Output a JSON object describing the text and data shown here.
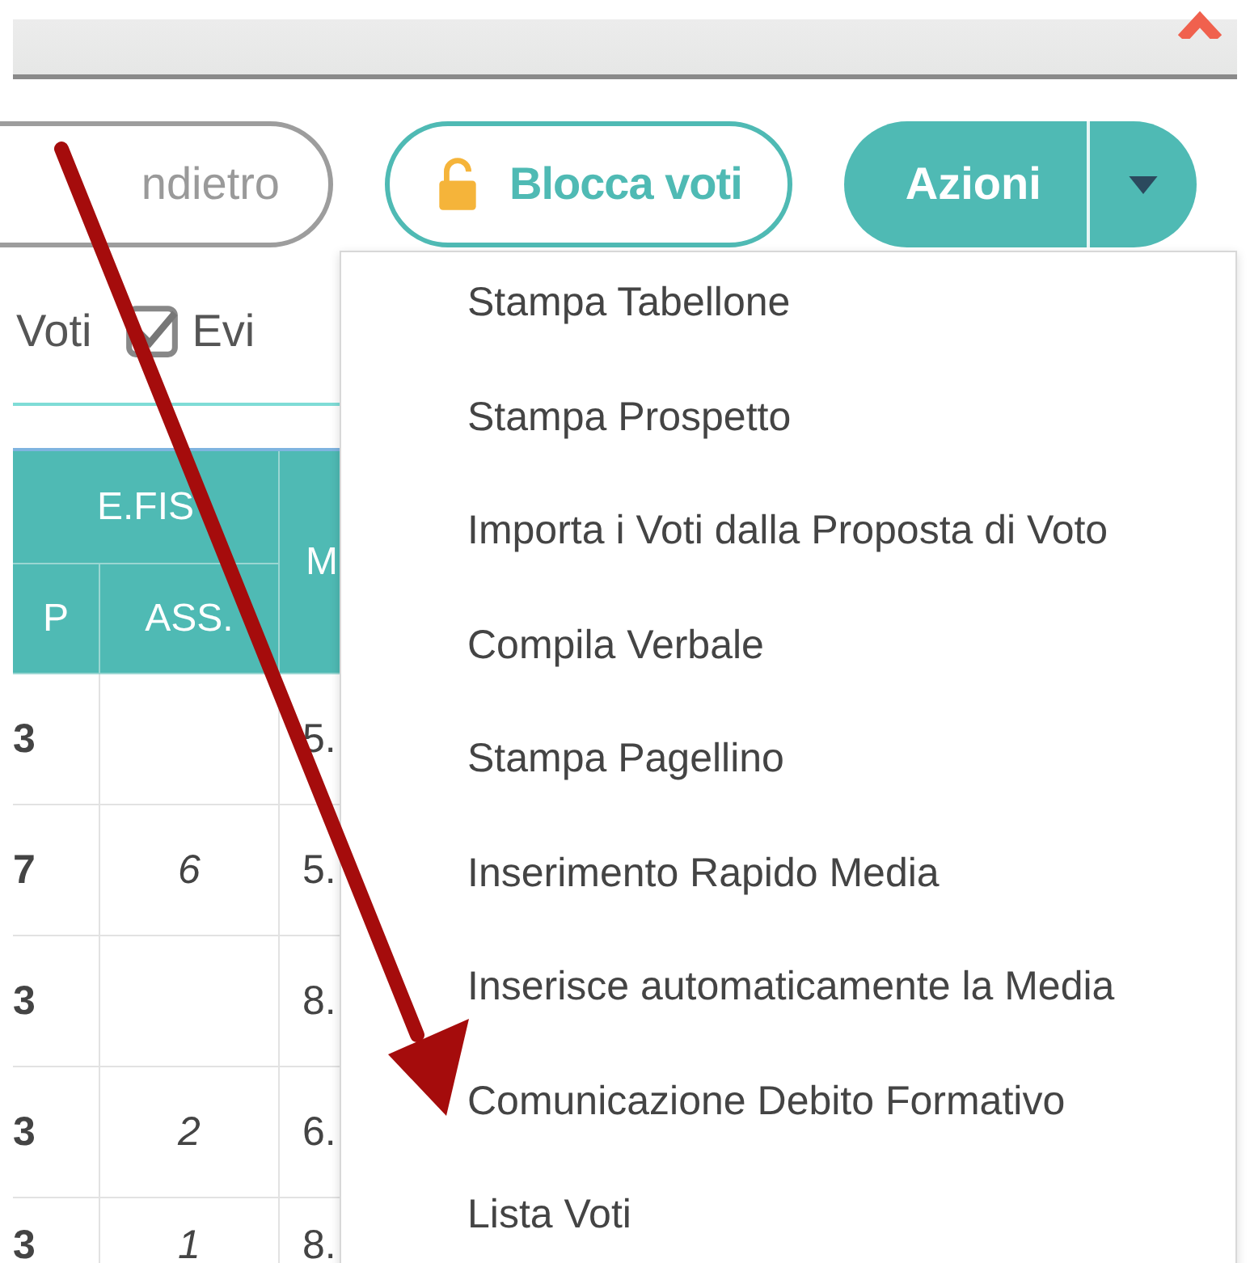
{
  "buttons": [
    {
      "label": "ndietro",
      "kind": "outline"
    },
    {
      "label": "Blocca voti",
      "kind": "lock"
    },
    {
      "label": "Azioni",
      "kind": "split"
    }
  ],
  "options": [
    {
      "label": "Voti"
    },
    {
      "label": "Evi",
      "checked": true
    }
  ],
  "table": {
    "group": "E.FIS",
    "columns": [
      "P",
      "ASS.",
      "M"
    ],
    "rows": [
      {
        "col_1": "3",
        "col_3": "5."
      },
      {
        "col_1": "7",
        "ass": "6",
        "col_3": "5."
      },
      {
        "col_1": "3",
        "col_3": "8."
      },
      {
        "col_1": "3",
        "ass": "2",
        "col_3": "6."
      },
      {
        "col_1": "3",
        "ass": "1",
        "col_3": "8."
      }
    ]
  },
  "menu": [
    "Stampa Tabellone",
    "Stampa Prospetto",
    "Importa i Voti dalla Proposta di Voto",
    "Compila Verbale",
    "Stampa Pagellino",
    "Inserimento Rapido Media",
    "Inserisce automaticamente la Media",
    "Comunicazione Debito Formativo",
    "Lista Voti"
  ]
}
